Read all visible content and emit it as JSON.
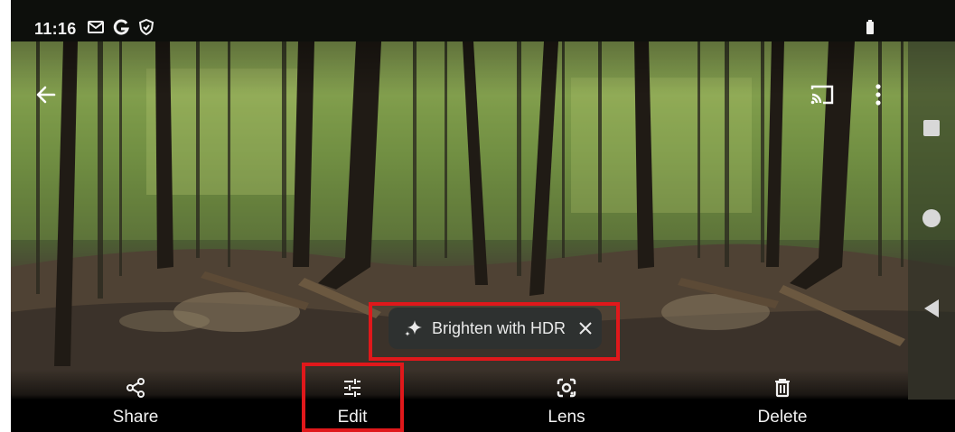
{
  "status_bar": {
    "time": "11:16",
    "left_icons": [
      "gmail-icon",
      "google-icon",
      "shield-icon"
    ],
    "right_icons": [
      "battery-icon"
    ]
  },
  "top_bar": {
    "back_icon": "arrow-back-icon",
    "cast_icon": "cast-icon",
    "more_icon": "more-vert-icon"
  },
  "nav_rail": {
    "icons": [
      "recents-square-icon",
      "home-circle-icon",
      "back-triangle-icon"
    ]
  },
  "suggestion_chip": {
    "icon": "sparkle-icon",
    "label": "Brighten with HDR",
    "dismiss_icon": "close-icon"
  },
  "actions": [
    {
      "label": "Share",
      "icon": "share-icon"
    },
    {
      "label": "Edit",
      "icon": "tune-icon"
    },
    {
      "label": "Lens",
      "icon": "lens-icon"
    },
    {
      "label": "Delete",
      "icon": "trash-icon"
    }
  ],
  "colors": {
    "highlight": "#e0181b",
    "chip_bg": "#2e3130",
    "status_bg": "#0d0f0c"
  }
}
